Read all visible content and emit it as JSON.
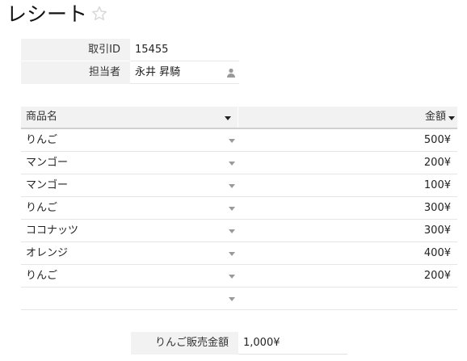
{
  "page": {
    "title": "レシート"
  },
  "record": {
    "fields": [
      {
        "label": "取引ID",
        "value": "15455"
      },
      {
        "label": "担当者",
        "value": "永井 昇騎"
      }
    ]
  },
  "table": {
    "columns": {
      "name": "商品名",
      "amount": "金額"
    },
    "rows": [
      {
        "name": "りんご",
        "amount": "500¥"
      },
      {
        "name": "マンゴー",
        "amount": "200¥"
      },
      {
        "name": "マンゴー",
        "amount": "100¥"
      },
      {
        "name": "りんご",
        "amount": "300¥"
      },
      {
        "name": "ココナッツ",
        "amount": "300¥"
      },
      {
        "name": "オレンジ",
        "amount": "400¥"
      },
      {
        "name": "りんご",
        "amount": "200¥"
      }
    ]
  },
  "summary": {
    "label": "りんご販売金額",
    "value": "1,000¥"
  },
  "icons": {
    "star": "star-outline-icon",
    "person": "person-icon",
    "caret": "caret-down-icon"
  },
  "colors": {
    "header_bg": "#f2f2f2",
    "star": "#d8d8d8",
    "caret_light": "#9a9a9a"
  }
}
